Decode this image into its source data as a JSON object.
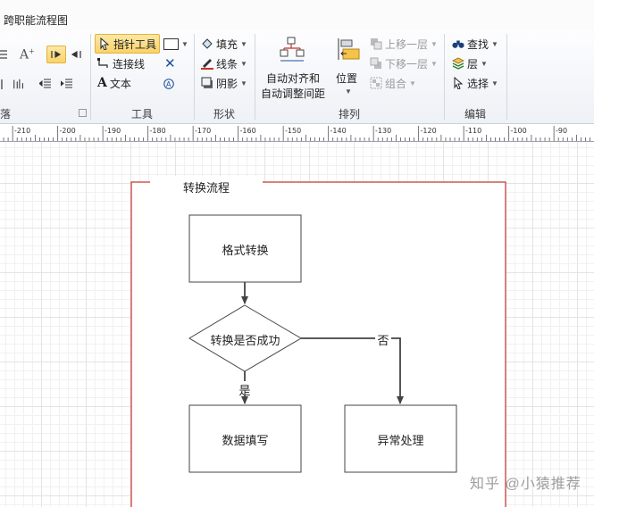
{
  "tab": {
    "label": "跨职能流程图"
  },
  "ribbon": {
    "groups": {
      "partial": "落",
      "tools": "工具",
      "shape": "形状",
      "arrange": "排列",
      "edit": "编辑"
    },
    "tools": {
      "pointer": "指针工具",
      "connector": "连接线",
      "text": "文本"
    },
    "shape": {
      "fill": "填充",
      "line": "线条",
      "shadow": "阴影"
    },
    "arrange": {
      "auto_align_line1": "自动对齐和",
      "auto_align_line2": "自动调整间距",
      "position": "位置",
      "bring_forward": "上移一层",
      "send_backward": "下移一层",
      "group": "组合"
    },
    "edit": {
      "find": "查找",
      "layer": "层",
      "select": "选择"
    }
  },
  "ruler": {
    "labels": [
      "-210",
      "-200",
      "-190",
      "-180",
      "-170",
      "-160",
      "-150",
      "-140",
      "-130",
      "-120",
      "-110",
      "-100",
      "-90"
    ]
  },
  "diagram": {
    "pool_title": "转换流程",
    "step_format": "格式转换",
    "decision": "转换是否成功",
    "yes_label": "是",
    "no_label": "否",
    "step_fill": "数据填写",
    "step_error": "异常处理"
  },
  "watermark": "知乎 @小猿推荐",
  "colors": {
    "pool_border": "#c0312b",
    "shape_border": "#444444",
    "active_button": "#f9d26a"
  }
}
